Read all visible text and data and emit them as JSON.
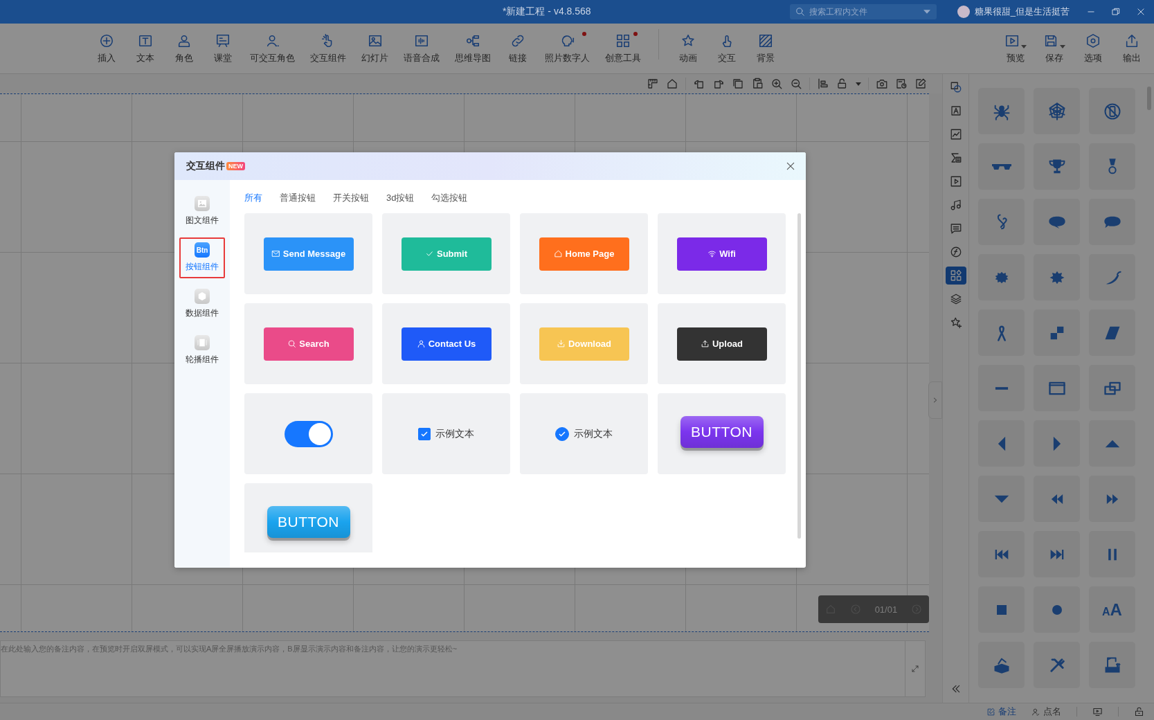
{
  "window": {
    "title": "*新建工程 - v4.8.568",
    "search": {
      "placeholder": "搜索工程内文件"
    },
    "user": {
      "name": "糖果很甜_但是生活挺苦"
    }
  },
  "toolbar": {
    "left": [
      {
        "label": "插入",
        "dot": false
      },
      {
        "label": "文本",
        "dot": false
      },
      {
        "label": "角色",
        "dot": false
      },
      {
        "label": "课堂",
        "dot": false
      },
      {
        "label": "可交互角色",
        "dot": false
      },
      {
        "label": "交互组件",
        "dot": false
      },
      {
        "label": "幻灯片",
        "dot": false
      },
      {
        "label": "语音合成",
        "dot": false
      },
      {
        "label": "思维导图",
        "dot": false
      },
      {
        "label": "链接",
        "dot": false
      },
      {
        "label": "照片数字人",
        "dot": true
      },
      {
        "label": "创意工具",
        "dot": true
      },
      {
        "label": "动画",
        "dot": false
      },
      {
        "label": "交互",
        "dot": false
      },
      {
        "label": "背景",
        "dot": false
      }
    ],
    "right": [
      {
        "label": "预览",
        "dropdown": true
      },
      {
        "label": "保存",
        "dropdown": true
      },
      {
        "label": "选项",
        "dropdown": false
      },
      {
        "label": "输出",
        "dropdown": false
      }
    ]
  },
  "tool_strip": [
    {
      "selected": false
    },
    {
      "selected": false
    },
    {
      "selected": false
    },
    {
      "selected": false
    },
    {
      "selected": false
    },
    {
      "selected": false
    },
    {
      "selected": false
    },
    {
      "selected": false
    },
    {
      "selected": true
    },
    {
      "selected": false
    },
    {
      "selected": false
    }
  ],
  "shape_library": {
    "text_tile": "AA"
  },
  "page_nav": {
    "counter": "01/01"
  },
  "notes": {
    "placeholder": "在此处输入您的备注内容，在预览时开启双屏模式，可以实现A屏全屏播放演示内容，B屏显示演示内容和备注内容，让您的演示更轻松~"
  },
  "status_bar": {
    "tabs": [
      {
        "label": "备注",
        "selected": true
      },
      {
        "label": "点名",
        "selected": false
      }
    ]
  },
  "dialog": {
    "title": "交互组件",
    "badge": "NEW",
    "sidebar": [
      {
        "label": "图文组件",
        "selected": false
      },
      {
        "label": "按钮组件",
        "selected": true,
        "icon_text": "Btn"
      },
      {
        "label": "数据组件",
        "selected": false
      },
      {
        "label": "轮播组件",
        "selected": false
      }
    ],
    "tabs": [
      {
        "label": "所有",
        "selected": true
      },
      {
        "label": "普通按钮",
        "selected": false
      },
      {
        "label": "开关按钮",
        "selected": false
      },
      {
        "label": "3d按钮",
        "selected": false
      },
      {
        "label": "勾选按钮",
        "selected": false
      }
    ],
    "cards": [
      {
        "kind": "button",
        "label": "Send Message",
        "color": "#2b93f8"
      },
      {
        "kind": "button",
        "label": "Submit",
        "color": "#1fbb9a"
      },
      {
        "kind": "button",
        "label": "Home Page",
        "color": "#ff6f1d"
      },
      {
        "kind": "button",
        "label": "Wifi",
        "color": "#7b2ae8"
      },
      {
        "kind": "button",
        "label": "Search",
        "color": "#ea4b89"
      },
      {
        "kind": "button",
        "label": "Contact Us",
        "color": "#1f5af8"
      },
      {
        "kind": "button",
        "label": "Download",
        "color": "#f7c553"
      },
      {
        "kind": "button",
        "label": "Upload",
        "color": "#333333"
      },
      {
        "kind": "switch",
        "on": true
      },
      {
        "kind": "checkbox",
        "label": "示例文本",
        "checked": true
      },
      {
        "kind": "round-check",
        "label": "示例文本",
        "checked": true
      },
      {
        "kind": "button3d",
        "label": "BUTTON",
        "color": "#7b35ee"
      },
      {
        "kind": "button3d",
        "label": "BUTTON",
        "color": "#1aa3ee"
      }
    ]
  }
}
